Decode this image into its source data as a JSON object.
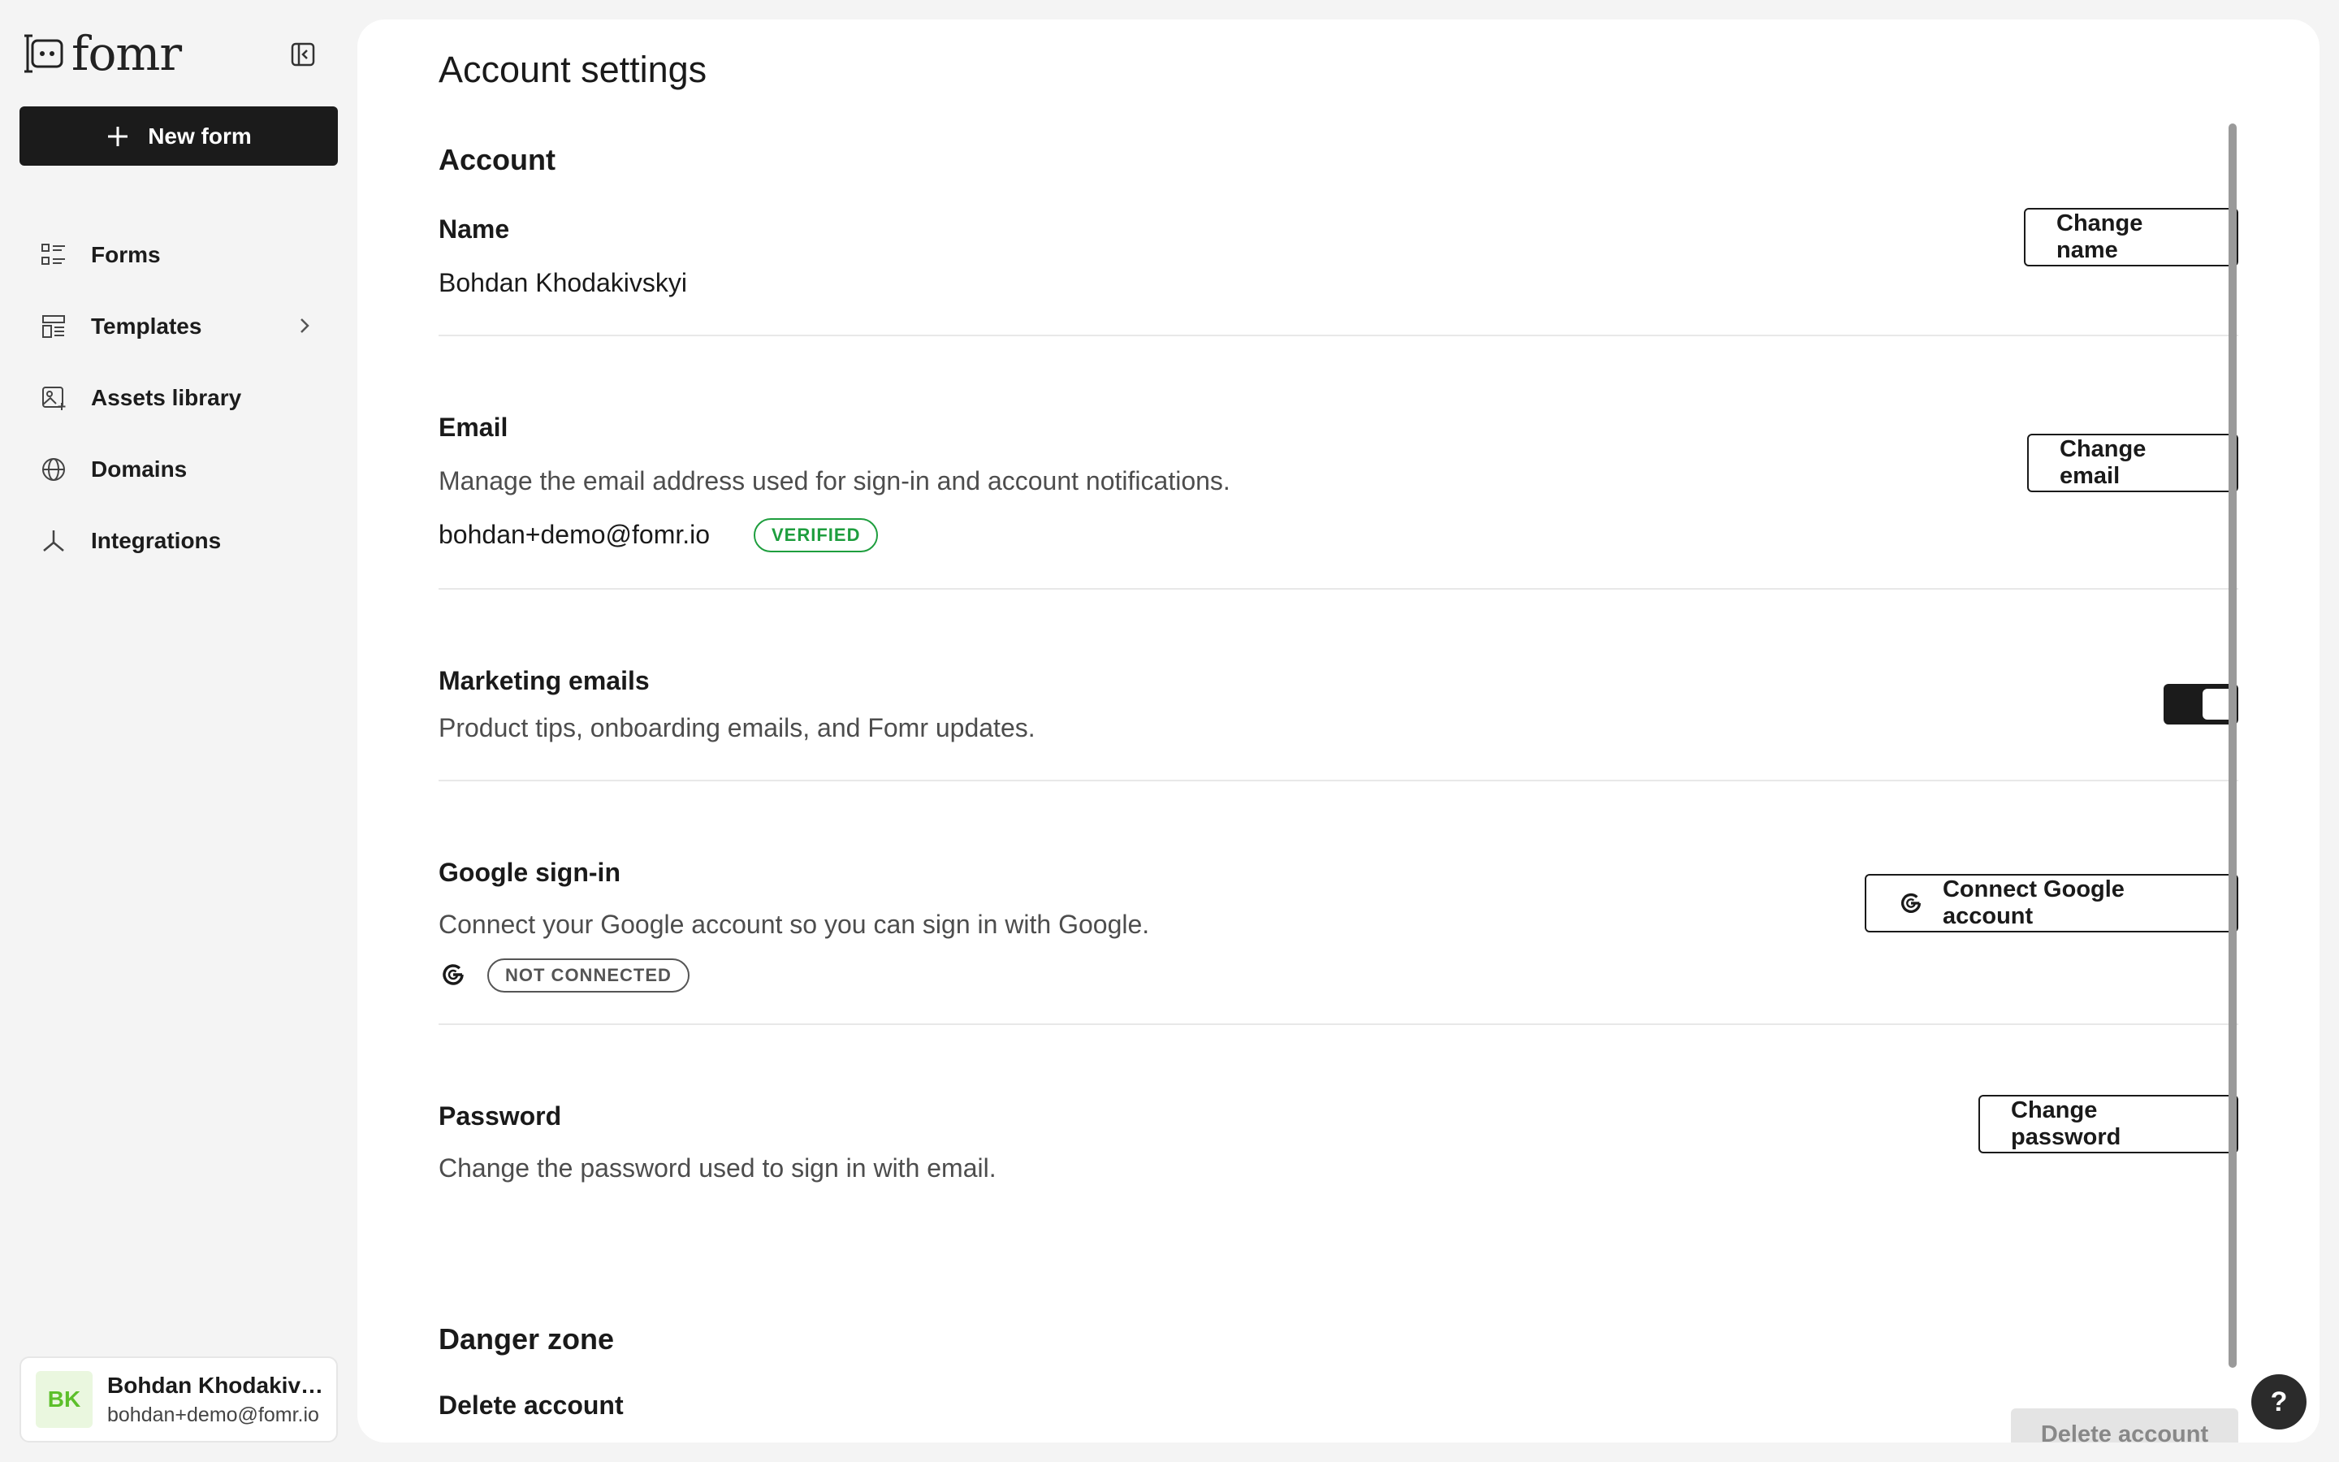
{
  "app": {
    "logo_text": "fomr"
  },
  "sidebar": {
    "new_form_label": "New form",
    "items": [
      {
        "label": "Forms",
        "icon": "list-icon"
      },
      {
        "label": "Templates",
        "icon": "layout-icon",
        "has_chevron": true
      },
      {
        "label": "Assets library",
        "icon": "image-icon"
      },
      {
        "label": "Domains",
        "icon": "globe-icon"
      },
      {
        "label": "Integrations",
        "icon": "branch-icon"
      }
    ],
    "user": {
      "initials": "BK",
      "name": "Bohdan Khodakivskyi",
      "email": "bohdan+demo@fomr.io"
    }
  },
  "main": {
    "title": "Account settings",
    "account_heading": "Account",
    "name": {
      "label": "Name",
      "value": "Bohdan Khodakivskyi",
      "button": "Change name"
    },
    "email": {
      "label": "Email",
      "description": "Manage the email address used for sign-in and account notifications.",
      "value": "bohdan+demo@fomr.io",
      "badge": "VERIFIED",
      "button": "Change email"
    },
    "marketing": {
      "label": "Marketing emails",
      "description": "Product tips, onboarding emails, and Fomr updates.",
      "enabled": true
    },
    "google": {
      "label": "Google sign-in",
      "description": "Connect your Google account so you can sign in with Google.",
      "badge": "NOT CONNECTED",
      "button": "Connect Google account"
    },
    "password": {
      "label": "Password",
      "description": "Change the password used to sign in with email.",
      "button": "Change password"
    },
    "danger": {
      "heading": "Danger zone",
      "label": "Delete account",
      "button": "Delete account"
    }
  },
  "help_label": "?",
  "colors": {
    "accent_dark": "#1b1b1b",
    "verified_green": "#1e9e3e",
    "avatar_green": "#5cbf2a"
  }
}
